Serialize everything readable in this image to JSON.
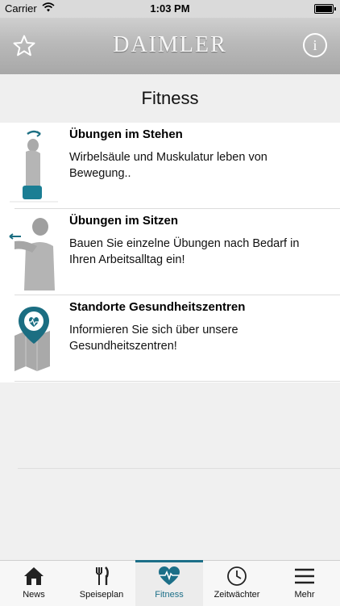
{
  "status_bar": {
    "carrier": "Carrier",
    "time": "1:03 PM"
  },
  "nav_bar": {
    "logo": "DAIMLER",
    "info_icon": "i"
  },
  "page": {
    "title": "Fitness"
  },
  "items": [
    {
      "title": "Übungen im Stehen",
      "description": "Wirbelsäule und Muskulatur leben von Bewegung..",
      "icon": "standing-exercise-icon"
    },
    {
      "title": "Übungen im Sitzen",
      "description": "Bauen Sie einzelne Übungen nach Bedarf in Ihren Arbeitsalltag ein!",
      "icon": "sitting-exercise-icon"
    },
    {
      "title": "Standorte Gesundheitszentren",
      "description": "Informieren Sie sich über unsere Gesundheitszentren!",
      "icon": "health-center-map-icon"
    }
  ],
  "tabs": [
    {
      "label": "News",
      "icon": "home-icon"
    },
    {
      "label": "Speiseplan",
      "icon": "fork-knife-icon"
    },
    {
      "label": "Fitness",
      "icon": "heart-pulse-icon",
      "active": true
    },
    {
      "label": "Zeitwächter",
      "icon": "clock-icon"
    },
    {
      "label": "Mehr",
      "icon": "menu-icon"
    }
  ],
  "colors": {
    "accent": "#1c6f88",
    "teal_icon": "#1b6e82"
  }
}
